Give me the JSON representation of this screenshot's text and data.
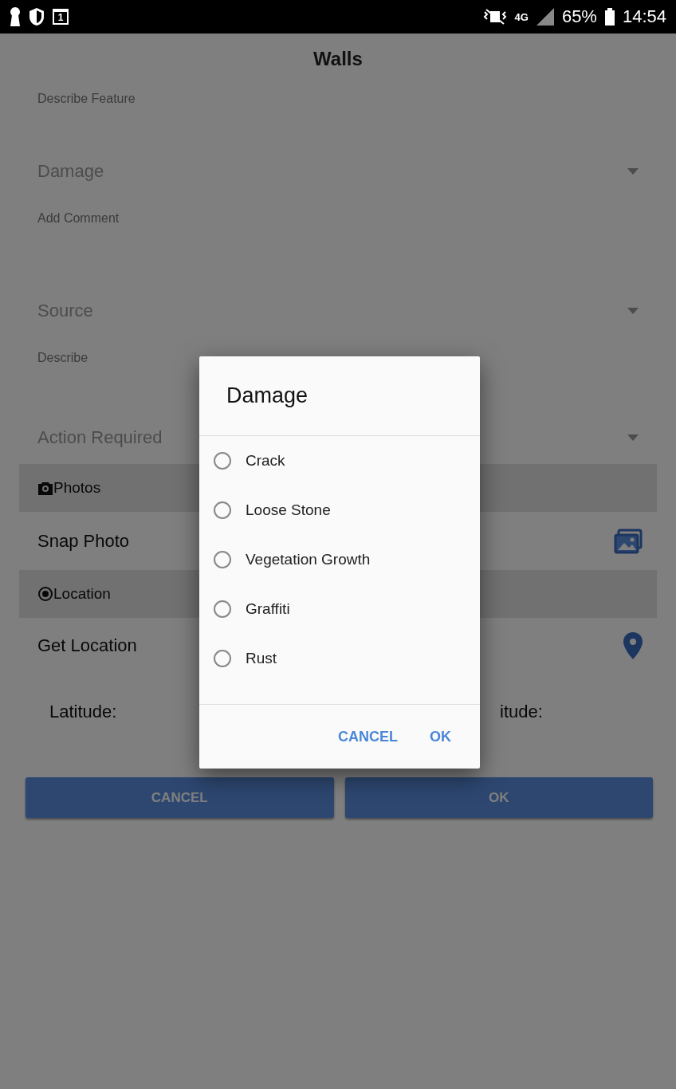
{
  "status_bar": {
    "calendar_day": "1",
    "network": "4G",
    "battery": "65%",
    "time": "14:54"
  },
  "title": "Walls",
  "fields": [
    {
      "kind": "text",
      "label": "Describe Feature"
    },
    {
      "kind": "dropdown",
      "placeholder": "Damage"
    },
    {
      "kind": "text",
      "label": "Add Comment"
    },
    {
      "kind": "dropdown",
      "placeholder": "Source"
    },
    {
      "kind": "text",
      "label": "Describe"
    },
    {
      "kind": "dropdown",
      "placeholder": "Action Required"
    }
  ],
  "photos": {
    "header": "Photos",
    "action": "Snap Photo"
  },
  "location": {
    "header": "Location",
    "action": "Get Location",
    "latitude_label": "Latitude:",
    "longitude_label": "itude:"
  },
  "buttons": [
    {
      "label": "CANCEL"
    },
    {
      "label": "OK"
    }
  ],
  "dialog": {
    "title": "Damage",
    "options": [
      {
        "label": "Crack",
        "selected": false
      },
      {
        "label": "Loose Stone",
        "selected": false
      },
      {
        "label": "Vegetation Growth",
        "selected": false
      },
      {
        "label": "Graffiti",
        "selected": false
      },
      {
        "label": "Rust",
        "selected": false
      }
    ],
    "buttons": [
      {
        "label": "CANCEL"
      },
      {
        "label": "OK"
      }
    ]
  }
}
